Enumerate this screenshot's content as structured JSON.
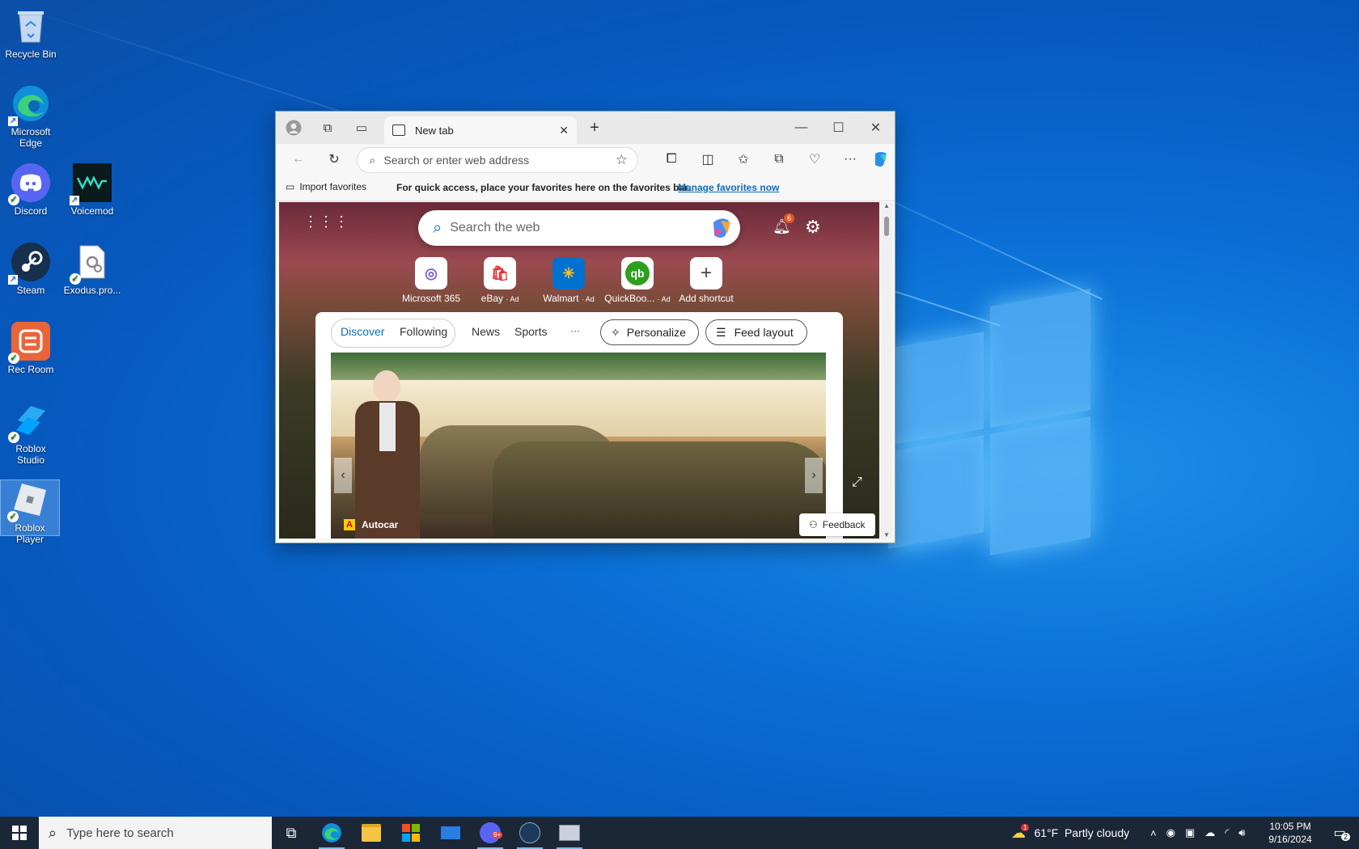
{
  "desktop": {
    "icons": [
      {
        "label": "Recycle Bin"
      },
      {
        "label": "Microsoft Edge"
      },
      {
        "label": "Discord"
      },
      {
        "label": "Voicemod"
      },
      {
        "label": "Steam"
      },
      {
        "label": "Exodus.pro..."
      },
      {
        "label": "Rec Room"
      },
      {
        "label": "Roblox Studio"
      },
      {
        "label": "Roblox Player"
      }
    ]
  },
  "browser": {
    "tab_title": "New tab",
    "address_placeholder": "Search or enter web address",
    "favbar": {
      "import_label": "Import favorites",
      "message": "For quick access, place your favorites here on the favorites bar.",
      "manage_link": "Manage favorites now"
    },
    "ntp": {
      "search_placeholder": "Search the web",
      "notification_count": "6",
      "shortcuts": [
        {
          "label": "Microsoft 365",
          "ad": ""
        },
        {
          "label": "eBay",
          "ad": "· Ad"
        },
        {
          "label": "Walmart",
          "ad": "· Ad"
        },
        {
          "label": "QuickBoo...",
          "ad": "· Ad"
        },
        {
          "label": "Add shortcut",
          "ad": ""
        }
      ],
      "feed_tabs": {
        "discover": "Discover",
        "following": "Following",
        "news": "News",
        "sports": "Sports",
        "more": "···"
      },
      "personalize_label": "Personalize",
      "feed_layout_label": "Feed layout",
      "hero_source": "Autocar",
      "feedback_label": "Feedback"
    }
  },
  "taskbar": {
    "search_placeholder": "Type here to search",
    "weather": "61°F  Partly cloudy",
    "weather_badge": "1",
    "time": "10:05 PM",
    "date": "9/16/2024",
    "notification_count": "2",
    "discord_badge": "9+"
  },
  "colors": {
    "desktop_blue": "#0a6fd6",
    "taskbar": "#1b2737",
    "edge_accent": "#0f6cbd",
    "discord": "#5865f2"
  }
}
